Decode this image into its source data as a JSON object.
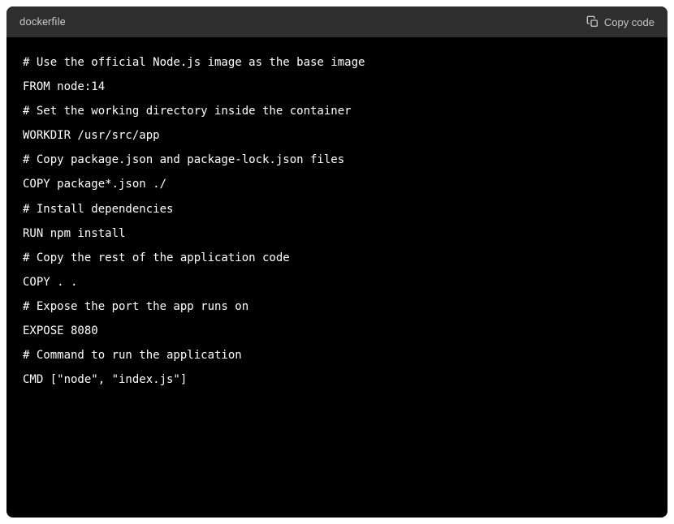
{
  "header": {
    "language": "dockerfile",
    "copy_label": "Copy code"
  },
  "code": {
    "lines": [
      "# Use the official Node.js image as the base image",
      "FROM node:14",
      "",
      "# Set the working directory inside the container",
      "WORKDIR /usr/src/app",
      "",
      "# Copy package.json and package-lock.json files",
      "COPY package*.json ./",
      "",
      "# Install dependencies",
      "RUN npm install",
      "",
      "# Copy the rest of the application code",
      "COPY . .",
      "",
      "# Expose the port the app runs on",
      "EXPOSE 8080",
      "",
      "# Command to run the application",
      "CMD [\"node\", \"index.js\"]"
    ]
  }
}
